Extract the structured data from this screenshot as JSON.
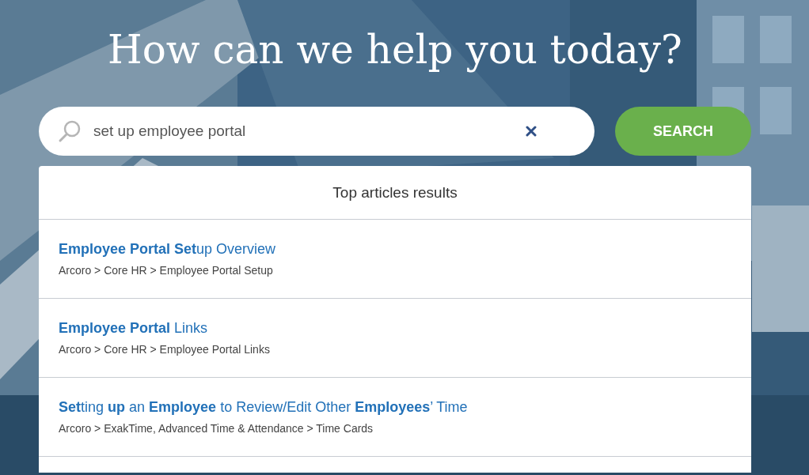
{
  "heading": "How can we help you today?",
  "search": {
    "value": "set up employee portal",
    "button": "SEARCH"
  },
  "results": {
    "header": "Top articles results",
    "items": [
      {
        "title": "**Employee Portal Set**up Overview",
        "path": "Arcoro > Core HR > Employee Portal Setup"
      },
      {
        "title": "**Employee Portal** Links",
        "path": "Arcoro > Core HR > Employee Portal Links"
      },
      {
        "title": "**Set**ting **up** an **Employee** to Review/Edit Other **Employees**’ Time",
        "path": "Arcoro > ExakTime, Advanced Time & Attendance > Time Cards"
      }
    ]
  }
}
